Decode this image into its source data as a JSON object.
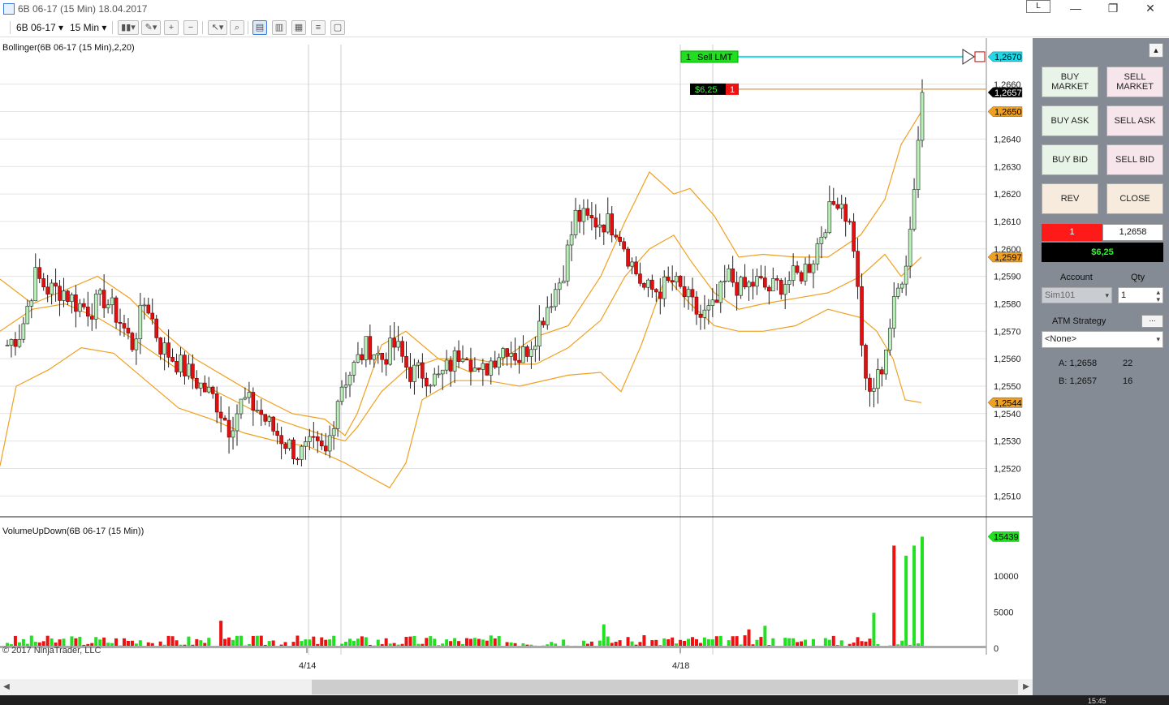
{
  "window": {
    "title": "6B 06-17 (15 Min)  18.04.2017",
    "link_button": "L",
    "minimize": "—",
    "restore": "❐",
    "close": "✕"
  },
  "toolbar": {
    "instrument": "6B 06-17",
    "interval": "15 Min"
  },
  "chart": {
    "price_indicator_label": "Bollinger(6B 06-17 (15 Min),2,20)",
    "volume_indicator_label": "VolumeUpDown(6B 06-17 (15 Min))",
    "copyright": "© 2017 NinjaTrader, LLC",
    "date_labels": [
      "4/14",
      "4/18"
    ],
    "price_ticks": [
      "1,2510",
      "1,2520",
      "1,2530",
      "1,2540",
      "1,2550",
      "1,2560",
      "1,2570",
      "1,2580",
      "1,2590",
      "1,2600",
      "1,2610",
      "1,2620",
      "1,2630",
      "1,2640",
      "1,2650",
      "1,2660"
    ],
    "volume_ticks": [
      "0",
      "5000",
      "10000"
    ],
    "markers": {
      "sell_limit_price": "1,2670",
      "last_price": "1,2657",
      "upper_band": "1,2650",
      "middle_band": "1,2597",
      "lower_band": "1,2544",
      "last_volume": "15439"
    },
    "order_tag": {
      "qty": "1",
      "label": "Sell LMT"
    },
    "position_tag": {
      "pnl": "$6,25",
      "qty": "1"
    }
  },
  "chart_data": {
    "type": "candlestick",
    "title": "6B 06-17 (15 Min)",
    "ylim": [
      1.2503,
      1.2675
    ],
    "volume_ylim": [
      0,
      16500
    ],
    "x_labels": [
      "4/14",
      "4/18"
    ],
    "price_anchors": [
      1.2565,
      1.257,
      1.259,
      1.2585,
      1.2585,
      1.258,
      1.2578,
      1.2582,
      1.2575,
      1.2565,
      1.2582,
      1.2565,
      1.256,
      1.2555,
      1.255,
      1.2545,
      1.2535,
      1.2545,
      1.2542,
      1.2535,
      1.253,
      1.2525,
      1.2528,
      1.2525,
      1.255,
      1.2557,
      1.2565,
      1.256,
      1.2565,
      1.2555,
      1.2555,
      1.2552,
      1.2558,
      1.2565,
      1.2553,
      1.256,
      1.2565,
      1.256,
      1.2568,
      1.258,
      1.259,
      1.2612,
      1.261,
      1.261,
      1.2608,
      1.2595,
      1.2585,
      1.2585,
      1.2588,
      1.2582,
      1.2575,
      1.2578,
      1.259,
      1.2585,
      1.2588,
      1.2585,
      1.2588,
      1.259,
      1.2595,
      1.261,
      1.262,
      1.2605,
      1.2545,
      1.2555,
      1.258,
      1.26,
      1.2657
    ],
    "upper_band_anchors": [
      [
        0,
        1.2589
      ],
      [
        40,
        1.258
      ],
      [
        80,
        1.2585
      ],
      [
        120,
        1.259
      ],
      [
        160,
        1.2582
      ],
      [
        200,
        1.257
      ],
      [
        240,
        1.256
      ],
      [
        280,
        1.2553
      ],
      [
        320,
        1.2546
      ],
      [
        360,
        1.254
      ],
      [
        400,
        1.2538
      ],
      [
        425,
        1.2532
      ],
      [
        440,
        1.254
      ],
      [
        470,
        1.2565
      ],
      [
        500,
        1.257
      ],
      [
        540,
        1.256
      ],
      [
        580,
        1.2555
      ],
      [
        620,
        1.256
      ],
      [
        660,
        1.2568
      ],
      [
        700,
        1.2572
      ],
      [
        740,
        1.259
      ],
      [
        770,
        1.261
      ],
      [
        800,
        1.2628
      ],
      [
        830,
        1.262
      ],
      [
        850,
        1.2622
      ],
      [
        880,
        1.2612
      ],
      [
        910,
        1.2597
      ],
      [
        940,
        1.2598
      ],
      [
        980,
        1.2597
      ],
      [
        1020,
        1.2597
      ],
      [
        1060,
        1.2605
      ],
      [
        1090,
        1.2618
      ],
      [
        1110,
        1.2638
      ],
      [
        1135,
        1.265
      ]
    ],
    "middle_band_anchors": [
      [
        0,
        1.257
      ],
      [
        40,
        1.2578
      ],
      [
        80,
        1.258
      ],
      [
        120,
        1.2575
      ],
      [
        160,
        1.2568
      ],
      [
        200,
        1.256
      ],
      [
        240,
        1.2552
      ],
      [
        280,
        1.2546
      ],
      [
        320,
        1.254
      ],
      [
        360,
        1.2536
      ],
      [
        400,
        1.2532
      ],
      [
        425,
        1.253
      ],
      [
        440,
        1.2535
      ],
      [
        470,
        1.2548
      ],
      [
        500,
        1.2556
      ],
      [
        540,
        1.256
      ],
      [
        580,
        1.256
      ],
      [
        620,
        1.2558
      ],
      [
        660,
        1.2558
      ],
      [
        700,
        1.2564
      ],
      [
        740,
        1.2574
      ],
      [
        770,
        1.259
      ],
      [
        800,
        1.26
      ],
      [
        830,
        1.2605
      ],
      [
        850,
        1.2596
      ],
      [
        880,
        1.2584
      ],
      [
        910,
        1.2578
      ],
      [
        940,
        1.258
      ],
      [
        980,
        1.2582
      ],
      [
        1020,
        1.2584
      ],
      [
        1060,
        1.259
      ],
      [
        1090,
        1.2598
      ],
      [
        1110,
        1.259
      ],
      [
        1135,
        1.2597
      ]
    ],
    "lower_band_anchors": [
      [
        0,
        1.2521
      ],
      [
        20,
        1.255
      ],
      [
        60,
        1.2556
      ],
      [
        100,
        1.2564
      ],
      [
        140,
        1.2562
      ],
      [
        180,
        1.2552
      ],
      [
        220,
        1.2542
      ],
      [
        260,
        1.2538
      ],
      [
        300,
        1.2533
      ],
      [
        340,
        1.253
      ],
      [
        380,
        1.2528
      ],
      [
        425,
        1.2522
      ],
      [
        455,
        1.2517
      ],
      [
        480,
        1.2513
      ],
      [
        500,
        1.2522
      ],
      [
        520,
        1.2545
      ],
      [
        560,
        1.2552
      ],
      [
        600,
        1.2552
      ],
      [
        640,
        1.255
      ],
      [
        700,
        1.2554
      ],
      [
        740,
        1.2555
      ],
      [
        765,
        1.2548
      ],
      [
        790,
        1.2565
      ],
      [
        820,
        1.259
      ],
      [
        850,
        1.258
      ],
      [
        880,
        1.2572
      ],
      [
        910,
        1.257
      ],
      [
        940,
        1.257
      ],
      [
        980,
        1.2572
      ],
      [
        1020,
        1.2578
      ],
      [
        1060,
        1.2575
      ],
      [
        1080,
        1.257
      ],
      [
        1100,
        1.256
      ],
      [
        1115,
        1.2545
      ],
      [
        1135,
        1.2544
      ]
    ],
    "volume_spikes": [
      {
        "x": 274,
        "v": 3800,
        "dir": "down"
      },
      {
        "x": 742,
        "v": 3300,
        "dir": "up"
      },
      {
        "x": 922,
        "v": 2600,
        "dir": "down"
      },
      {
        "x": 942,
        "v": 3100,
        "dir": "up"
      },
      {
        "x": 1078,
        "v": 4900,
        "dir": "up"
      },
      {
        "x": 1103,
        "v": 14200,
        "dir": "down"
      },
      {
        "x": 1118,
        "v": 12800,
        "dir": "up"
      },
      {
        "x": 1124,
        "v": 14200,
        "dir": "up"
      },
      {
        "x": 1134,
        "v": 15439,
        "dir": "up"
      }
    ]
  },
  "panel": {
    "buy_market": "BUY MARKET",
    "sell_market": "SELL MARKET",
    "buy_ask": "BUY ASK",
    "sell_ask": "SELL ASK",
    "buy_bid": "BUY BID",
    "sell_bid": "SELL BID",
    "rev": "REV",
    "close": "CLOSE",
    "position_qty": "1",
    "position_price": "1,2658",
    "position_pnl": "$6,25",
    "account_label": "Account",
    "qty_label": "Qty",
    "account_value": "Sim101",
    "qty_value": "1",
    "atm_label": "ATM Strategy",
    "atm_more": "...",
    "atm_value": "<None>",
    "ask_label": "A: 1,2658",
    "ask_size": "22",
    "bid_label": "B: 1,2657",
    "bid_size": "16"
  },
  "colors": {
    "up_candle": "#1f8f1f",
    "down_candle": "#e01010",
    "band": "#f0a020",
    "volume_up": "#22e022",
    "volume_down": "#ee1111",
    "sell_line": "#20d8e8",
    "pnl_line": "#e0a870"
  },
  "taskbar": {
    "clock": "15:45"
  }
}
